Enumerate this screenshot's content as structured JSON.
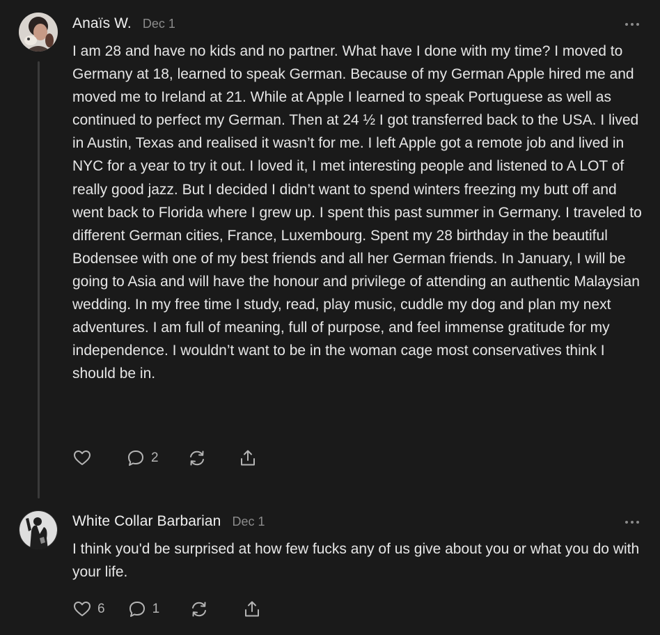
{
  "comments": [
    {
      "author": "Anaïs W.",
      "date": "Dec 1",
      "text": "I am 28 and have no kids and no partner. What have I done with my time? I moved to Germany at 18, learned to speak German. Because of my German Apple hired me and moved me to Ireland at 21. While at Apple I learned to speak Portuguese as well as continued to perfect my German. Then at 24 ½ I got transferred back to the USA. I lived in Austin, Texas and realised it wasn’t for me. I left Apple got a remote job and lived in NYC for a year to try it out. I loved it, I met interesting people and listened to A LOT of really good jazz. But I decided I didn’t want to spend winters freezing my butt off and went back to Florida where I grew up. I spent this past summer in Germany. I traveled to different German cities, France, Luxembourg. Spent my 28 birthday in the beautiful Bodensee with one of my best friends and all her German friends. In January, I will be going to Asia and will have the honour and privilege of attending an authentic Malaysian wedding. In my free time I study, read, play music, cuddle my dog and plan my next adventures. I am full of meaning, full of purpose, and feel immense gratitude for my independence. I wouldn’t want to be in the woman cage most conservatives think I should be in.",
      "like_count": "",
      "reply_count": "2"
    },
    {
      "author": "White Collar Barbarian",
      "date": "Dec 1",
      "text": "I think you'd be surprised at how few fucks any of us give about you or what you do with your life.",
      "like_count": "6",
      "reply_count": "1"
    }
  ],
  "icons": {
    "like": "heart-icon",
    "reply": "comment-bubble-icon",
    "restack": "restack-icon",
    "share": "share-icon",
    "more": "more-dots-icon"
  },
  "colors": {
    "background": "#1a1a1a",
    "text": "#e6e6e6",
    "muted": "#8c8c8c",
    "icon": "#b5b5b5"
  }
}
